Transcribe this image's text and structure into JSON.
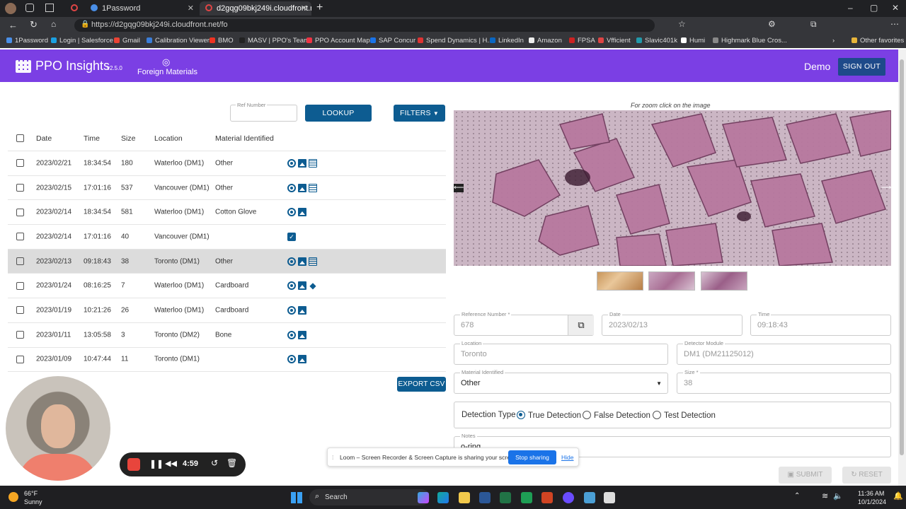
{
  "browser": {
    "tabs": [
      {
        "label": ""
      },
      {
        "label": "1Password"
      },
      {
        "label": "d2gqg09bkj249i.cloudfront.n"
      }
    ],
    "url": "https://d2gqg09bkj249i.cloudfront.net/fo",
    "bookmarks": [
      "1Password",
      "Login | Salesforce",
      "Gmail",
      "Calibration Viewer",
      "BMO",
      "MASV | PPO's Team",
      "PPO Account Map",
      "SAP Concur",
      "Spend Dynamics | H...",
      "LinkedIn",
      "Amazon",
      "FPSA",
      "Vfficient",
      "Slavic401k",
      "Humi",
      "Highmark Blue Cros..."
    ],
    "other_favorites": "Other favorites"
  },
  "header": {
    "brand": "PPO Insights",
    "version": "v2.5.0",
    "section": "Foreign Materials",
    "user": "Demo",
    "sign_out": "SIGN OUT"
  },
  "toolbar": {
    "ref_label": "Ref Number",
    "ref_value": "",
    "lookup": "LOOKUP",
    "filters": "FILTERS"
  },
  "table": {
    "headers": [
      "Date",
      "Time",
      "Size",
      "Location",
      "Material Identified"
    ],
    "rows": [
      {
        "date": "2023/02/21",
        "time": "18:34:54",
        "size": "180",
        "location": "Waterloo (DM1)",
        "material": "Other",
        "icons": [
          "eye",
          "image",
          "doc"
        ]
      },
      {
        "date": "2023/02/15",
        "time": "17:01:16",
        "size": "537",
        "location": "Vancouver (DM1)",
        "material": "Other",
        "icons": [
          "eye",
          "image",
          "doc"
        ]
      },
      {
        "date": "2023/02/14",
        "time": "18:34:54",
        "size": "581",
        "location": "Waterloo (DM1)",
        "material": "Cotton Glove",
        "icons": [
          "eye",
          "image"
        ]
      },
      {
        "date": "2023/02/14",
        "time": "17:01:16",
        "size": "40",
        "location": "Vancouver (DM1)",
        "material": "",
        "icons": [
          "check"
        ]
      },
      {
        "date": "2023/02/13",
        "time": "09:18:43",
        "size": "38",
        "location": "Toronto (DM1)",
        "material": "Other",
        "icons": [
          "eye",
          "image",
          "doc"
        ],
        "selected": true
      },
      {
        "date": "2023/01/24",
        "time": "08:16:25",
        "size": "7",
        "location": "Waterloo (DM1)",
        "material": "Cardboard",
        "icons": [
          "eye",
          "image",
          "layers"
        ]
      },
      {
        "date": "2023/01/19",
        "time": "10:21:26",
        "size": "26",
        "location": "Waterloo (DM1)",
        "material": "Cardboard",
        "icons": [
          "eye",
          "image"
        ]
      },
      {
        "date": "2023/01/11",
        "time": "13:05:58",
        "size": "3",
        "location": "Toronto (DM2)",
        "material": "Bone",
        "icons": [
          "eye",
          "image"
        ]
      },
      {
        "date": "2023/01/09",
        "time": "10:47:44",
        "size": "11",
        "location": "Toronto (DM1)",
        "material": "",
        "icons": [
          "eye",
          "image"
        ]
      }
    ],
    "export": "EXPORT CSV"
  },
  "detail": {
    "zoom_hint": "For zoom click on the image",
    "reference_number": {
      "label": "Reference Number *",
      "value": "678"
    },
    "date": {
      "label": "Date",
      "value": "2023/02/13"
    },
    "time": {
      "label": "Time",
      "value": "09:18:43"
    },
    "location": {
      "label": "Location",
      "value": "Toronto"
    },
    "detector": {
      "label": "Detector Module",
      "value": "DM1 (DM21125012)"
    },
    "material": {
      "label": "Material Identified",
      "value": "Other"
    },
    "size": {
      "label": "Size *",
      "value": "38"
    },
    "detection_type_label": "Detection Type",
    "detection_options": [
      "True Detection",
      "False Detection",
      "Test Detection"
    ],
    "notes": {
      "label": "Notes",
      "value": "o-ring"
    },
    "submit": "SUBMIT",
    "reset": "RESET"
  },
  "loom": {
    "message": "Loom – Screen Recorder & Screen Capture is sharing your screen.",
    "stop": "Stop sharing",
    "hide": "Hide",
    "timer": "4:59"
  },
  "taskbar": {
    "temp": "66°F",
    "weather": "Sunny",
    "search": "Search",
    "time": "11:36 AM",
    "date": "10/1/2024"
  },
  "colors": {
    "header": "#7b3fe4",
    "primary": "#0d5c91"
  }
}
